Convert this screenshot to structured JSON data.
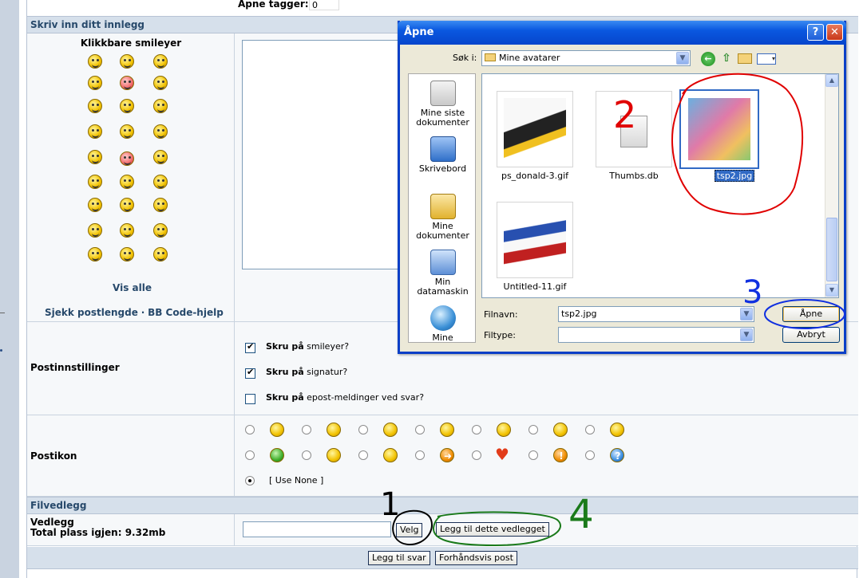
{
  "top": {
    "tags_label": "Åpne tagger:",
    "tags_value": "0"
  },
  "compose": {
    "section_title": "Skriv inn ditt innlegg",
    "smileys_title": "Klikkbare smileyer",
    "show_all": "Vis alle",
    "check_length": "Sjekk postlengde",
    "separator": "·",
    "bbcode_help": "BB Code-hjelp"
  },
  "options": {
    "label": "Postinnstillinger",
    "items": [
      {
        "bold": "Skru på",
        "rest": "smileyer?",
        "checked": true
      },
      {
        "bold": "Skru på",
        "rest": "signatur?",
        "checked": true
      },
      {
        "bold": "Skru på",
        "rest": "epost-meldinger ved svar?",
        "checked": false
      }
    ]
  },
  "posticons": {
    "label": "Postikon",
    "use_none": "[ Use None ]"
  },
  "attachments": {
    "section_title": "Filvedlegg",
    "label": "Vedlegg",
    "space_left": "Total plass igjen: 9.32mb",
    "choose_button": "Velg",
    "add_button": "Legg til dette vedlegget"
  },
  "footer": {
    "reply_button": "Legg til svar",
    "preview_button": "Forhåndsvis post"
  },
  "dialog": {
    "title": "Åpne",
    "help_button": "?",
    "close_button": "✕",
    "look_in_label": "Søk i:",
    "look_in_value": "Mine avatarer",
    "places": [
      {
        "label": "Mine siste dokumenter"
      },
      {
        "label": "Skrivebord"
      },
      {
        "label": "Mine dokumenter"
      },
      {
        "label": "Min datamaskin"
      },
      {
        "label": "Mine"
      }
    ],
    "files": [
      {
        "name": "ps_donald-3.gif"
      },
      {
        "name": "Thumbs.db"
      },
      {
        "name": "tsp2.jpg",
        "selected": true
      },
      {
        "name": "Untitled-11.gif"
      }
    ],
    "filename_label": "Filnavn:",
    "filename_value": "tsp2.jpg",
    "filetype_label": "Filtype:",
    "filetype_value": "",
    "open_button": "Åpne",
    "cancel_button": "Avbryt"
  },
  "annotations": {
    "n1": "1",
    "n2": "2",
    "n3": "3",
    "n4": "4"
  },
  "colors": {
    "section_header": "#d6e0eb",
    "link": "#27496b",
    "dialog_title": "#0a58e0",
    "annotation_red": "#e00000",
    "annotation_blue": "#1030e0",
    "annotation_green": "#1a7a1a"
  }
}
